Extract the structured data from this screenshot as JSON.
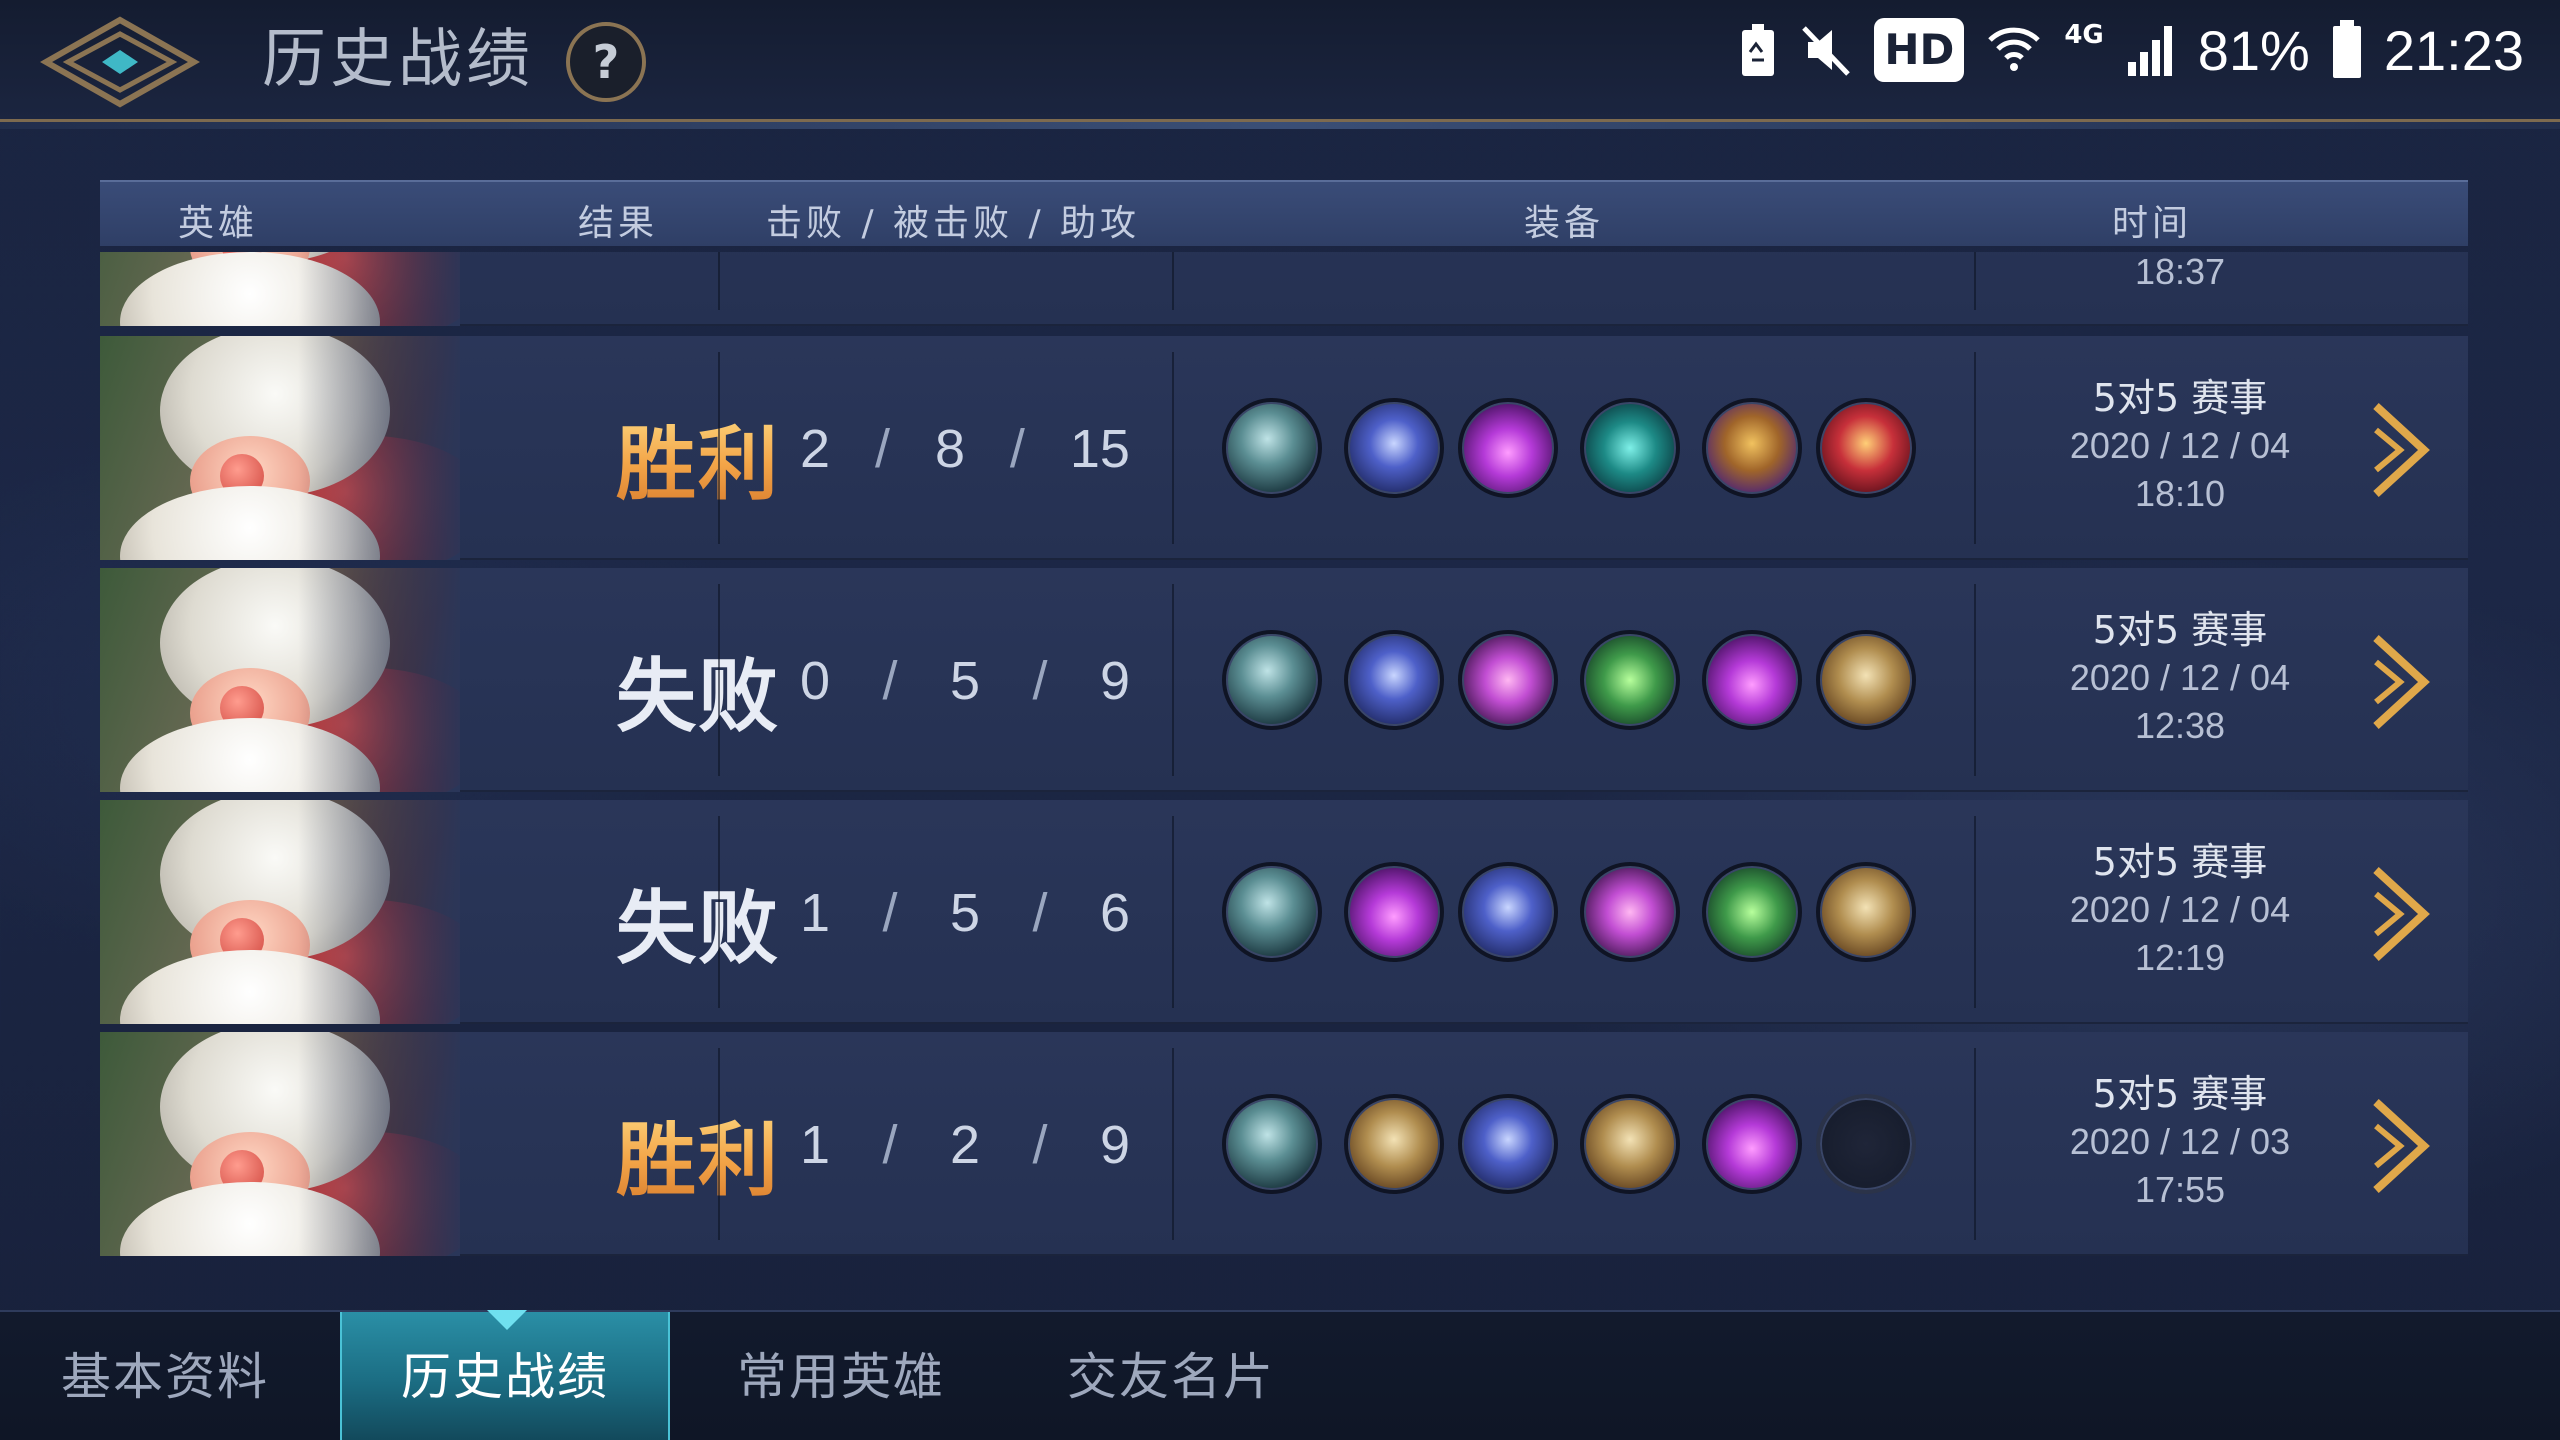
{
  "header": {
    "title": "历史战绩",
    "help_label": "?"
  },
  "status_bar": {
    "hd": "HD",
    "network": "4G",
    "battery": "81%",
    "time": "21:23"
  },
  "table": {
    "columns": [
      "英雄",
      "结果",
      "击败 / 被击败 / 助攻",
      "装备",
      "时间"
    ],
    "partial_row": {
      "clock": "18:37"
    },
    "rows": [
      {
        "result": "胜利",
        "status": "win",
        "kills": "2",
        "deaths": "8",
        "assists": "15",
        "items": [
          "helm",
          "boots",
          "purple",
          "teal",
          "gold",
          "crimson"
        ],
        "mode": "5对5 赛事",
        "date": "2020 / 12 / 04",
        "clock": "18:10"
      },
      {
        "result": "失败",
        "status": "lose",
        "kills": "0",
        "deaths": "5",
        "assists": "9",
        "items": [
          "helm",
          "boots",
          "tome",
          "green",
          "purple",
          "scroll"
        ],
        "mode": "5对5 赛事",
        "date": "2020 / 12 / 04",
        "clock": "12:38"
      },
      {
        "result": "失败",
        "status": "lose",
        "kills": "1",
        "deaths": "5",
        "assists": "6",
        "items": [
          "helm",
          "purple",
          "boots",
          "tome",
          "green",
          "scroll"
        ],
        "mode": "5对5 赛事",
        "date": "2020 / 12 / 04",
        "clock": "12:19"
      },
      {
        "result": "胜利",
        "status": "win",
        "kills": "1",
        "deaths": "2",
        "assists": "9",
        "items": [
          "helm",
          "scroll",
          "boots",
          "scroll",
          "purple",
          "empty"
        ],
        "mode": "5对5 赛事",
        "date": "2020 / 12 / 03",
        "clock": "17:55"
      }
    ]
  },
  "tabs": [
    {
      "label": "基本资料",
      "active": false
    },
    {
      "label": "历史战绩",
      "active": true
    },
    {
      "label": "常用英雄",
      "active": false
    },
    {
      "label": "交友名片",
      "active": false
    }
  ]
}
